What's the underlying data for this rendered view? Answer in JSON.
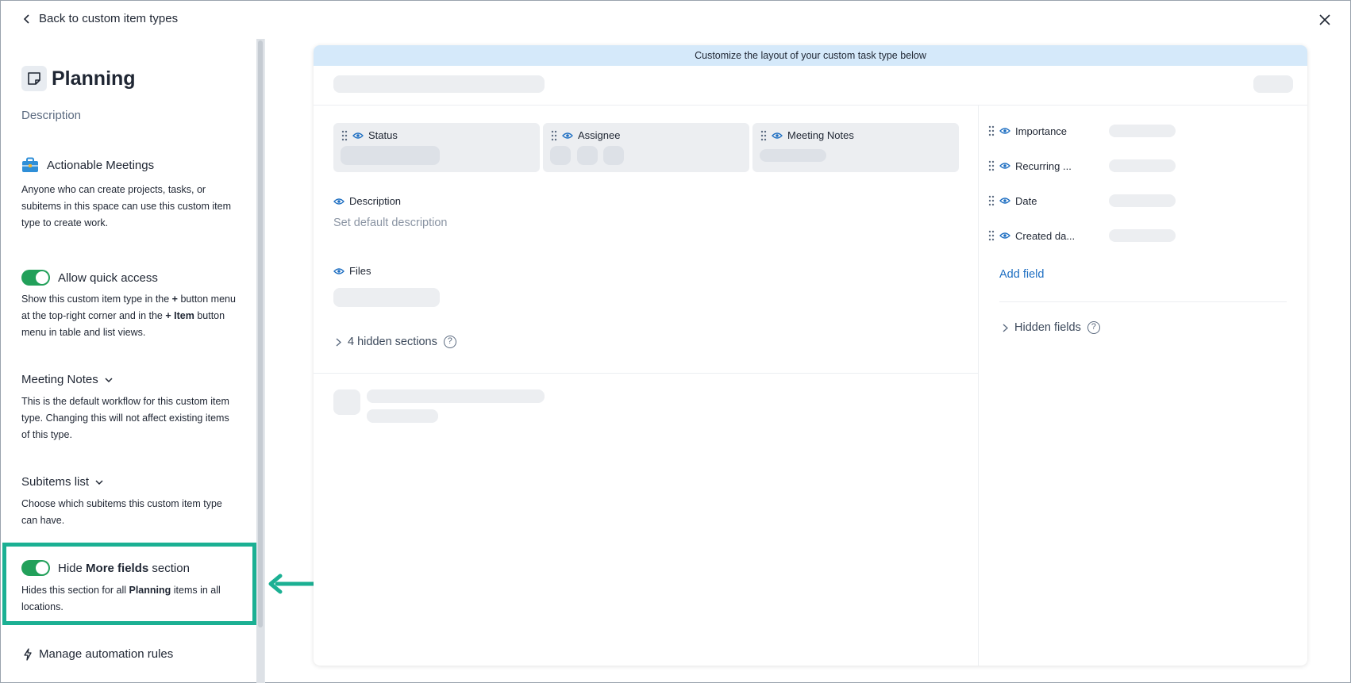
{
  "nav": {
    "back_label": "Back to custom item types"
  },
  "sidebar": {
    "title": "Planning",
    "description_link": "Description",
    "space": {
      "name": "Actionable Meetings",
      "text": "Anyone who can create projects, tasks, or subitems in this space can use this custom item type to create work."
    },
    "quick_access": {
      "label": "Allow quick access",
      "enabled": true,
      "text_a": "Show this custom item type in the ",
      "text_plus1": "+",
      "text_b": " button menu at the top-right corner and in the ",
      "text_plus_item": "+ Item",
      "text_c": " button menu in table and list views."
    },
    "workflow": {
      "label": "Meeting Notes",
      "text": "This is the default workflow for this custom item type. Changing this will not affect existing items of this type."
    },
    "subitems": {
      "label": "Subitems list",
      "text": "Choose which subitems this custom item type can have."
    },
    "hide_more_fields": {
      "label_a": "Hide ",
      "label_bold": "More fields",
      "label_b": " section",
      "enabled": true,
      "text_a": "Hides this section for all ",
      "text_bold": "Planning",
      "text_b": " items in all locations."
    },
    "automation": {
      "label": "Manage automation rules"
    }
  },
  "canvas": {
    "banner": "Customize the layout of your custom task type below",
    "top_fields": [
      "Status",
      "Assignee",
      "Meeting Notes"
    ],
    "description_label": "Description",
    "description_placeholder": "Set default description",
    "files_label": "Files",
    "hidden_sections": "4 hidden sections",
    "side_fields": [
      "Importance",
      "Recurring ...",
      "Date",
      "Created da..."
    ],
    "add_field": "Add field",
    "hidden_fields": "Hidden fields"
  },
  "colors": {
    "accent_green": "#22a05a",
    "highlight": "#1bb093",
    "link_blue": "#1f6fc2",
    "banner": "#d5e9fa"
  },
  "icons": [
    "chevron-left-icon",
    "close-icon",
    "note-icon",
    "briefcase-icon",
    "chevron-down-icon",
    "lightning-icon",
    "grip-icon",
    "eye-icon",
    "chevron-right-icon",
    "help-icon"
  ]
}
